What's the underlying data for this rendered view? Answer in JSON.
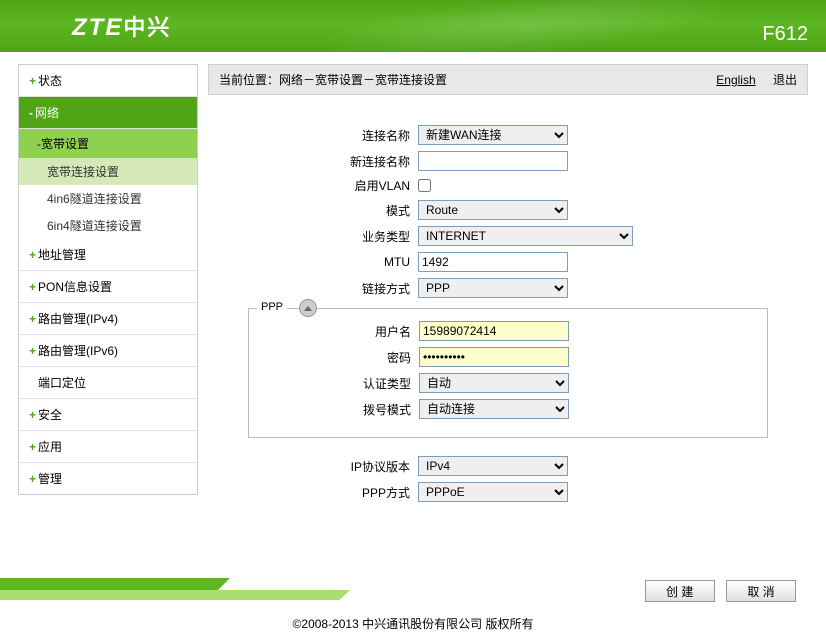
{
  "header": {
    "logo_en": "ZTE",
    "logo_cn": "中兴",
    "model": "F612"
  },
  "topbar": {
    "breadcrumb": "当前位置：网络－宽带设置－宽带连接设置",
    "english": "English",
    "logout": "退出"
  },
  "sidebar": {
    "status": "状态",
    "network": "网络",
    "broadband": "宽带设置",
    "sub": {
      "conn": "宽带连接设置",
      "v4in6": "4in6隧道连接设置",
      "v6in4": "6in4隧道连接设置"
    },
    "addr": "地址管理",
    "pon": "PON信息设置",
    "route4": "路由管理(IPv4)",
    "route6": "路由管理(IPv6)",
    "port": "端口定位",
    "security": "安全",
    "app": "应用",
    "manage": "管理"
  },
  "form": {
    "conn_name_label": "连接名称",
    "conn_name_value": "新建WAN连接",
    "new_name_label": "新连接名称",
    "new_name_value": "",
    "vlan_label": "启用VLAN",
    "mode_label": "模式",
    "mode_value": "Route",
    "service_label": "业务类型",
    "service_value": "INTERNET",
    "mtu_label": "MTU",
    "mtu_value": "1492",
    "link_label": "链接方式",
    "link_value": "PPP",
    "ppp_legend": "PPP",
    "user_label": "用户名",
    "user_value": "15989072414",
    "pass_label": "密码",
    "pass_value": "••••••••••",
    "auth_label": "认证类型",
    "auth_value": "自动",
    "dial_label": "拨号模式",
    "dial_value": "自动连接",
    "ipver_label": "IP协议版本",
    "ipver_value": "IPv4",
    "pppmode_label": "PPP方式",
    "pppmode_value": "PPPoE"
  },
  "footer": {
    "create": "创 建",
    "cancel": "取 消",
    "copyright": "©2008-2013 中兴通讯股份有限公司 版权所有"
  }
}
